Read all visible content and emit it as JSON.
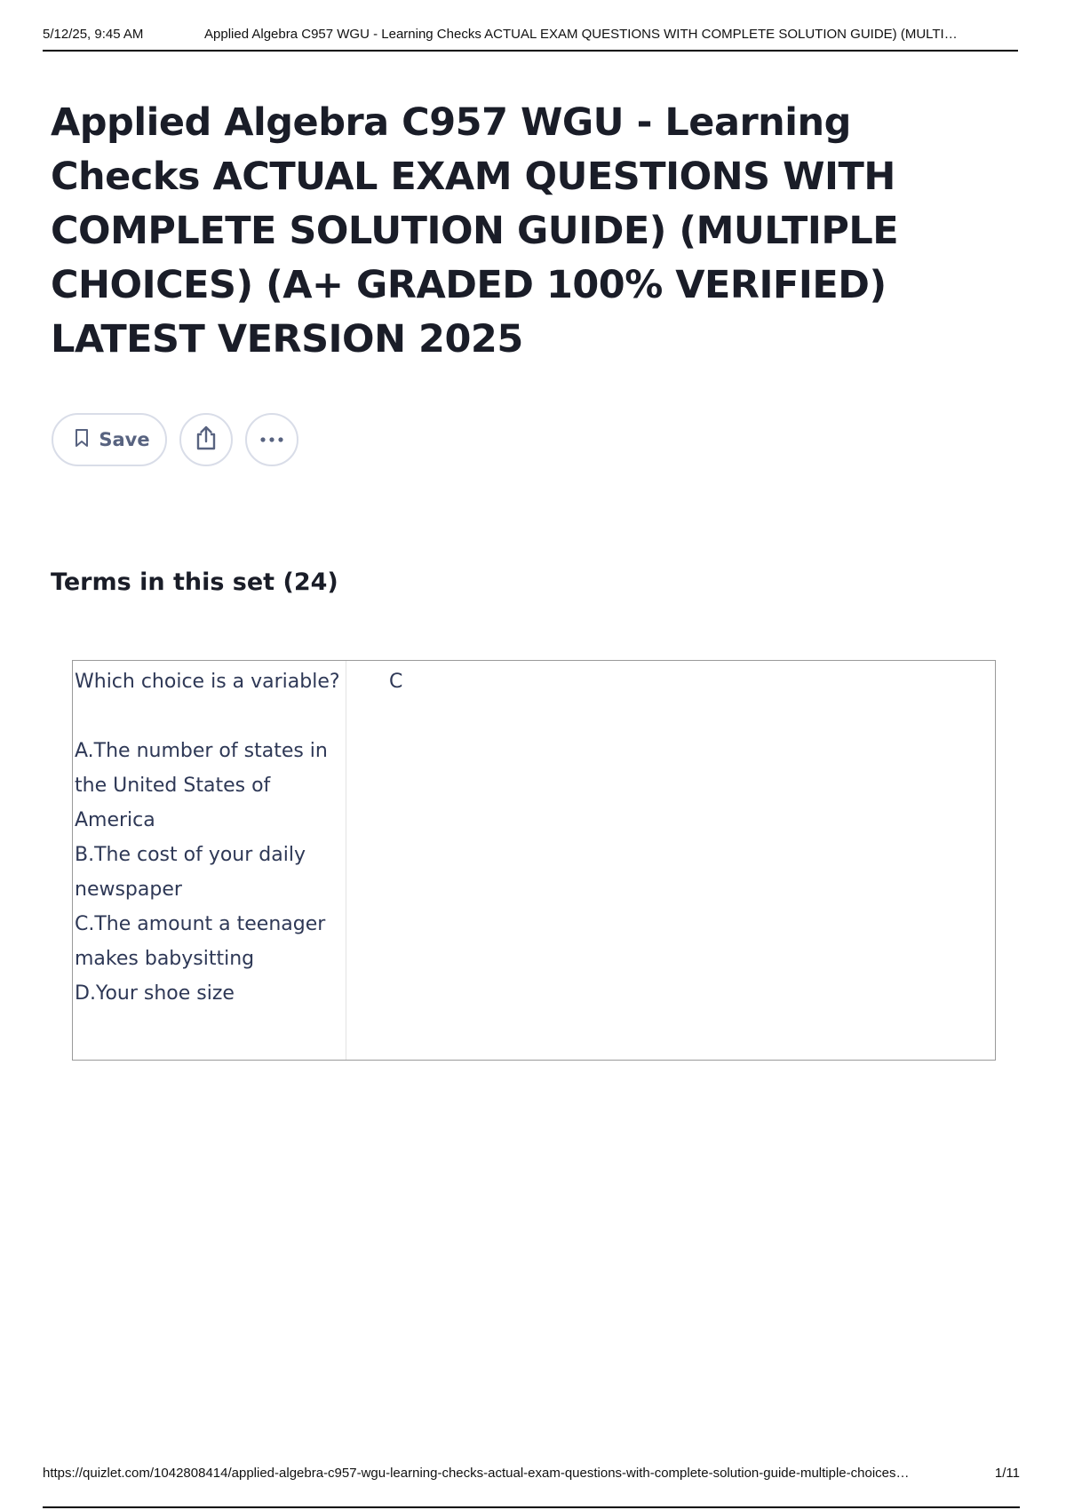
{
  "print_header": {
    "timestamp": "5/12/25, 9:45 AM",
    "doc_title": "Applied Algebra C957 WGU - Learning Checks ACTUAL EXAM QUESTIONS WITH COMPLETE SOLUTION GUIDE) (MULTI…"
  },
  "page": {
    "title": "Applied Algebra C957 WGU - Learning Checks ACTUAL EXAM QUESTIONS WITH COMPLETE SOLUTION GUIDE) (MULTIPLE CHOICES) (A+ GRADED 100% VERIFIED) LATEST VERSION 2025"
  },
  "actions": {
    "save_label": "Save",
    "icons": [
      "bookmark-icon",
      "share-icon",
      "more-icon"
    ]
  },
  "terms": {
    "heading": "Terms in this set (24)",
    "items": [
      {
        "question": "Which choice is a variable?",
        "options": [
          "A.The number of states in the United States of America",
          "B.The cost of your daily newspaper",
          "C.The amount a teenager makes babysitting",
          "D.Your shoe size"
        ],
        "answer": "C"
      }
    ]
  },
  "print_footer": {
    "url": "https://quizlet.com/1042808414/applied-algebra-c957-wgu-learning-checks-actual-exam-questions-with-complete-solution-guide-multiple-choices…",
    "page_number": "1/11"
  }
}
